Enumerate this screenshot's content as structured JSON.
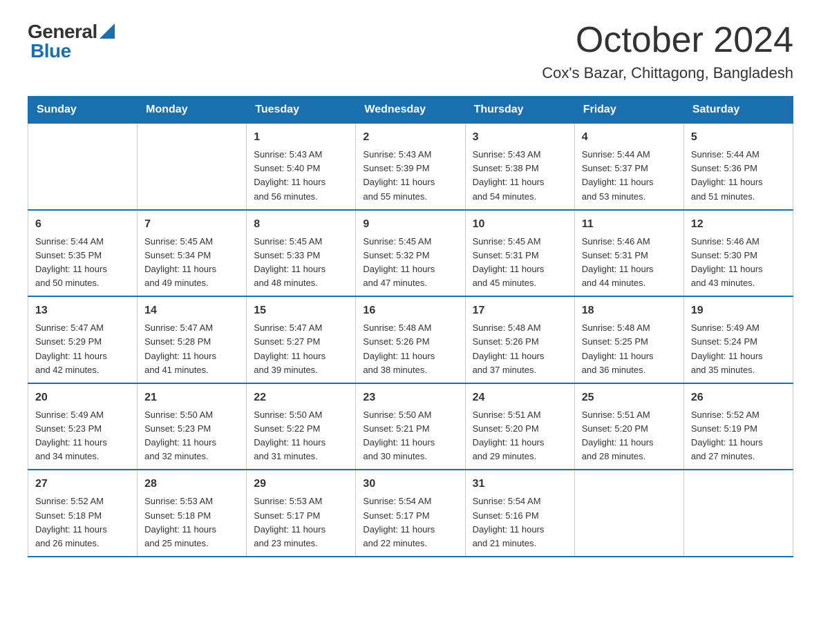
{
  "logo": {
    "general": "General",
    "blue": "Blue"
  },
  "title": "October 2024",
  "subtitle": "Cox's Bazar, Chittagong, Bangladesh",
  "weekdays": [
    "Sunday",
    "Monday",
    "Tuesday",
    "Wednesday",
    "Thursday",
    "Friday",
    "Saturday"
  ],
  "weeks": [
    [
      {
        "day": "",
        "info": ""
      },
      {
        "day": "",
        "info": ""
      },
      {
        "day": "1",
        "info": "Sunrise: 5:43 AM\nSunset: 5:40 PM\nDaylight: 11 hours\nand 56 minutes."
      },
      {
        "day": "2",
        "info": "Sunrise: 5:43 AM\nSunset: 5:39 PM\nDaylight: 11 hours\nand 55 minutes."
      },
      {
        "day": "3",
        "info": "Sunrise: 5:43 AM\nSunset: 5:38 PM\nDaylight: 11 hours\nand 54 minutes."
      },
      {
        "day": "4",
        "info": "Sunrise: 5:44 AM\nSunset: 5:37 PM\nDaylight: 11 hours\nand 53 minutes."
      },
      {
        "day": "5",
        "info": "Sunrise: 5:44 AM\nSunset: 5:36 PM\nDaylight: 11 hours\nand 51 minutes."
      }
    ],
    [
      {
        "day": "6",
        "info": "Sunrise: 5:44 AM\nSunset: 5:35 PM\nDaylight: 11 hours\nand 50 minutes."
      },
      {
        "day": "7",
        "info": "Sunrise: 5:45 AM\nSunset: 5:34 PM\nDaylight: 11 hours\nand 49 minutes."
      },
      {
        "day": "8",
        "info": "Sunrise: 5:45 AM\nSunset: 5:33 PM\nDaylight: 11 hours\nand 48 minutes."
      },
      {
        "day": "9",
        "info": "Sunrise: 5:45 AM\nSunset: 5:32 PM\nDaylight: 11 hours\nand 47 minutes."
      },
      {
        "day": "10",
        "info": "Sunrise: 5:45 AM\nSunset: 5:31 PM\nDaylight: 11 hours\nand 45 minutes."
      },
      {
        "day": "11",
        "info": "Sunrise: 5:46 AM\nSunset: 5:31 PM\nDaylight: 11 hours\nand 44 minutes."
      },
      {
        "day": "12",
        "info": "Sunrise: 5:46 AM\nSunset: 5:30 PM\nDaylight: 11 hours\nand 43 minutes."
      }
    ],
    [
      {
        "day": "13",
        "info": "Sunrise: 5:47 AM\nSunset: 5:29 PM\nDaylight: 11 hours\nand 42 minutes."
      },
      {
        "day": "14",
        "info": "Sunrise: 5:47 AM\nSunset: 5:28 PM\nDaylight: 11 hours\nand 41 minutes."
      },
      {
        "day": "15",
        "info": "Sunrise: 5:47 AM\nSunset: 5:27 PM\nDaylight: 11 hours\nand 39 minutes."
      },
      {
        "day": "16",
        "info": "Sunrise: 5:48 AM\nSunset: 5:26 PM\nDaylight: 11 hours\nand 38 minutes."
      },
      {
        "day": "17",
        "info": "Sunrise: 5:48 AM\nSunset: 5:26 PM\nDaylight: 11 hours\nand 37 minutes."
      },
      {
        "day": "18",
        "info": "Sunrise: 5:48 AM\nSunset: 5:25 PM\nDaylight: 11 hours\nand 36 minutes."
      },
      {
        "day": "19",
        "info": "Sunrise: 5:49 AM\nSunset: 5:24 PM\nDaylight: 11 hours\nand 35 minutes."
      }
    ],
    [
      {
        "day": "20",
        "info": "Sunrise: 5:49 AM\nSunset: 5:23 PM\nDaylight: 11 hours\nand 34 minutes."
      },
      {
        "day": "21",
        "info": "Sunrise: 5:50 AM\nSunset: 5:23 PM\nDaylight: 11 hours\nand 32 minutes."
      },
      {
        "day": "22",
        "info": "Sunrise: 5:50 AM\nSunset: 5:22 PM\nDaylight: 11 hours\nand 31 minutes."
      },
      {
        "day": "23",
        "info": "Sunrise: 5:50 AM\nSunset: 5:21 PM\nDaylight: 11 hours\nand 30 minutes."
      },
      {
        "day": "24",
        "info": "Sunrise: 5:51 AM\nSunset: 5:20 PM\nDaylight: 11 hours\nand 29 minutes."
      },
      {
        "day": "25",
        "info": "Sunrise: 5:51 AM\nSunset: 5:20 PM\nDaylight: 11 hours\nand 28 minutes."
      },
      {
        "day": "26",
        "info": "Sunrise: 5:52 AM\nSunset: 5:19 PM\nDaylight: 11 hours\nand 27 minutes."
      }
    ],
    [
      {
        "day": "27",
        "info": "Sunrise: 5:52 AM\nSunset: 5:18 PM\nDaylight: 11 hours\nand 26 minutes."
      },
      {
        "day": "28",
        "info": "Sunrise: 5:53 AM\nSunset: 5:18 PM\nDaylight: 11 hours\nand 25 minutes."
      },
      {
        "day": "29",
        "info": "Sunrise: 5:53 AM\nSunset: 5:17 PM\nDaylight: 11 hours\nand 23 minutes."
      },
      {
        "day": "30",
        "info": "Sunrise: 5:54 AM\nSunset: 5:17 PM\nDaylight: 11 hours\nand 22 minutes."
      },
      {
        "day": "31",
        "info": "Sunrise: 5:54 AM\nSunset: 5:16 PM\nDaylight: 11 hours\nand 21 minutes."
      },
      {
        "day": "",
        "info": ""
      },
      {
        "day": "",
        "info": ""
      }
    ]
  ]
}
